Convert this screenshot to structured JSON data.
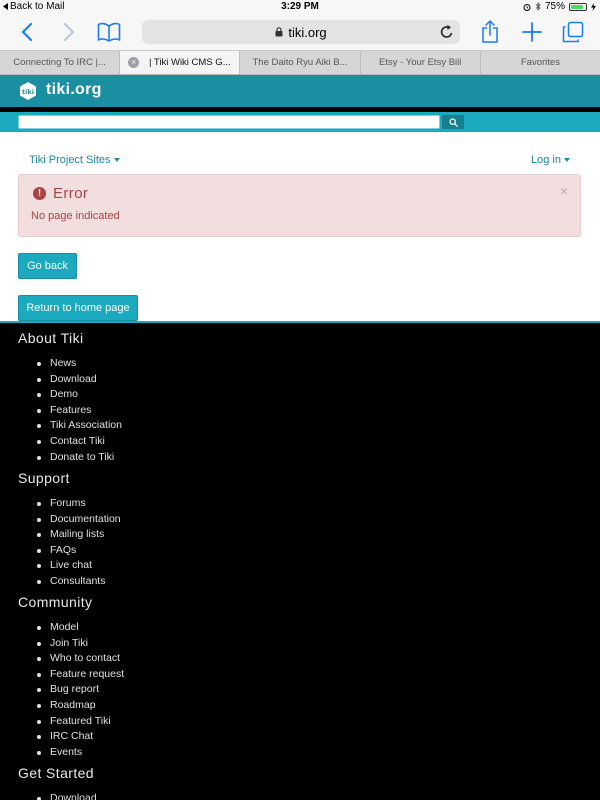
{
  "status": {
    "back_label": "Back to Mail",
    "time": "3:29 PM",
    "battery": "75%",
    "battery_level": 0.75
  },
  "toolbar": {
    "url": "tiki.org"
  },
  "tabs": [
    {
      "label": "Connecting To IRC |..."
    },
    {
      "label": "| Tiki Wiki CMS G..."
    },
    {
      "label": "The Daito Ryu Aiki B..."
    },
    {
      "label": "Etsy - Your Etsy Bill"
    },
    {
      "label": "Favorites"
    }
  ],
  "site": {
    "logo_text": "tiki",
    "title": "tiki.org"
  },
  "search": {
    "placeholder": ""
  },
  "nav": {
    "project_sites": "Tiki Project Sites",
    "login": "Log in"
  },
  "alert": {
    "title": "Error",
    "message": "No page indicated",
    "close": "×"
  },
  "buttons": {
    "go_back": "Go back",
    "home": "Return to home page"
  },
  "footer": {
    "sections": [
      {
        "heading": "About Tiki",
        "items": [
          "News",
          "Download",
          "Demo",
          "Features",
          "Tiki Association",
          "Contact Tiki",
          "Donate to Tiki"
        ]
      },
      {
        "heading": "Support",
        "items": [
          "Forums",
          "Documentation",
          "Mailing lists",
          "FAQs",
          "Live chat",
          "Consultants"
        ]
      },
      {
        "heading": "Community",
        "items": [
          "Model",
          "Join Tiki",
          "Who to contact",
          "Feature request",
          "Bug report",
          "Roadmap",
          "Featured Tiki",
          "IRC Chat",
          "Events"
        ]
      },
      {
        "heading": "Get Started",
        "items": [
          "Download"
        ]
      }
    ]
  }
}
